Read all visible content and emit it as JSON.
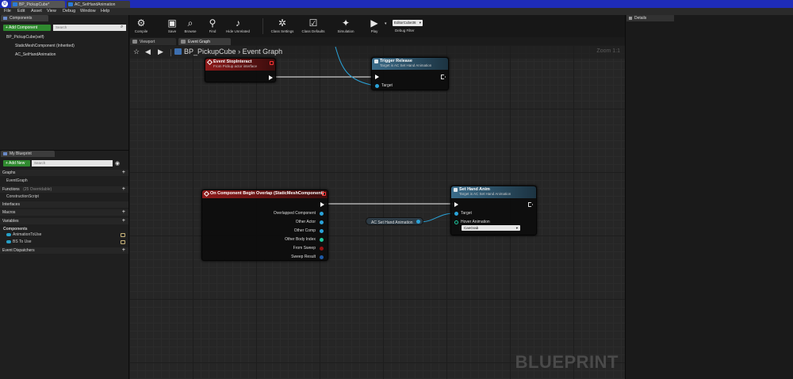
{
  "title_bar": {
    "tabs": [
      "BP_PickupCube*",
      "AC_SetHandAnimation"
    ]
  },
  "menu": {
    "items": [
      "File",
      "Edit",
      "Asset",
      "View",
      "Debug",
      "Window",
      "Help"
    ]
  },
  "toolbar": {
    "buttons": [
      {
        "label": "Compile",
        "icon": "compile-icon"
      },
      {
        "label": "Save",
        "icon": "save-icon"
      },
      {
        "label": "Browse",
        "icon": "browse-icon"
      },
      {
        "label": "Find",
        "icon": "find-icon"
      },
      {
        "label": "Hide Unrelated",
        "icon": "hide-unrelated-icon"
      },
      {
        "label": "Class Settings",
        "icon": "class-settings-icon"
      },
      {
        "label": "Class Defaults",
        "icon": "class-defaults-icon"
      },
      {
        "label": "Simulation",
        "icon": "simulation-icon"
      },
      {
        "label": "Play",
        "icon": "play-icon"
      }
    ],
    "debug_filter_value": "EditorCube36",
    "debug_filter_label": "Debug Filter"
  },
  "components_panel": {
    "tab": "Components",
    "add_button": "+ Add Component",
    "search_placeholder": "Search",
    "items": [
      "BP_PickupCube(self)",
      "StaticMeshComponent (Inherited)",
      "AC_SetHandAnimation"
    ]
  },
  "my_blueprint": {
    "tab": "My Blueprint",
    "add_button": "+ Add New",
    "search_placeholder": "Search",
    "sections": {
      "graphs": "Graphs",
      "event_graph": "EventGraph",
      "functions": "Functions",
      "functions_note": "(25 Overridable)",
      "construction": "ConstructionScript",
      "interfaces": "Interfaces",
      "macros": "Macros",
      "variables": "Variables",
      "components": "Components",
      "var1": "AnimationToUse",
      "var2": "BS To Use",
      "dispatchers": "Event Dispatchers"
    }
  },
  "graph": {
    "tabs": [
      "Viewport",
      "Event Graph"
    ],
    "breadcrumb_bp": "BP_PickupCube",
    "breadcrumb_sep": "›",
    "breadcrumb_graph": "Event Graph",
    "zoom": "Zoom 1:1",
    "watermark": "BLUEPRINT",
    "nodes": {
      "stop_interact": {
        "title": "Event StopInteract",
        "subtitle": "From Pickup actor interface"
      },
      "trigger_release": {
        "title": "Trigger Release",
        "subtitle": "Target is AC Set Hand Animation",
        "target": "Target"
      },
      "overlap": {
        "title": "On Component Begin Overlap (StaticMeshComponent)",
        "pins": [
          "Overlapped Component",
          "Other Actor",
          "Other Comp",
          "Other Body Index",
          "From Sweep",
          "Sweep Result"
        ]
      },
      "get_var": {
        "label": "AC Set Hand Animation"
      },
      "set_hand": {
        "title": "Set Hand Anim",
        "subtitle": "Target is AC Set Hand Animation",
        "target": "Target",
        "hover_label": "Hover Animation",
        "hover_value": "CanGrab"
      }
    }
  },
  "details_panel": {
    "tab": "Details"
  },
  "colors": {
    "event_header": "#8e1a1a",
    "function_header": "#3b6c8a",
    "object_pin": "#2aa3d9",
    "int_pin": "#1ec9a0",
    "bool_pin": "#9a1212",
    "struct_pin": "#1f5aa8"
  }
}
